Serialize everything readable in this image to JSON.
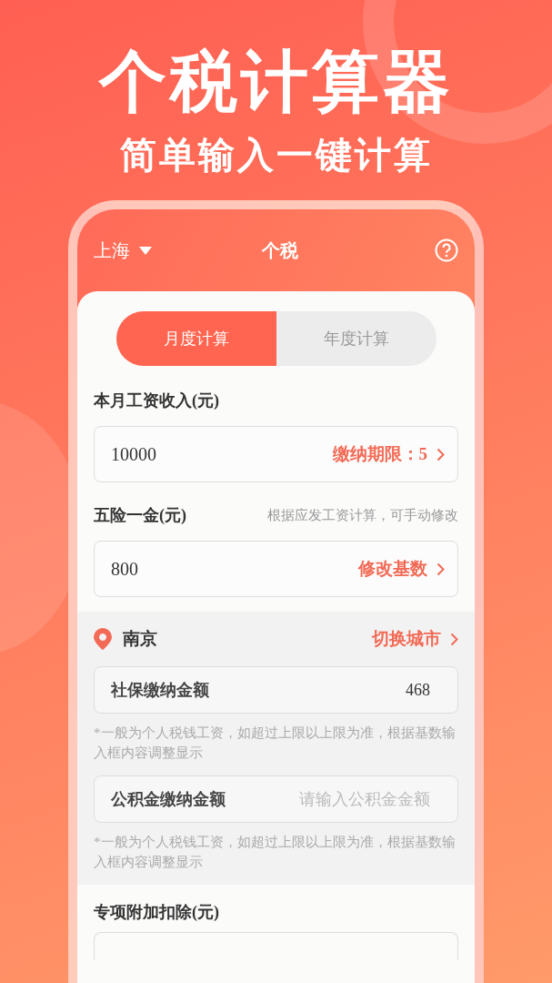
{
  "headline": "个税计算器",
  "subheadline": "简单输入一键计算",
  "app_bar": {
    "city": "上海",
    "title": "个税"
  },
  "tabs": [
    {
      "label": "月度计算",
      "selected": true
    },
    {
      "label": "年度计算",
      "selected": false
    }
  ],
  "salary": {
    "label": "本月工资收入(元)",
    "value": "10000",
    "action": "缴纳期限：5"
  },
  "insurance": {
    "label": "五险一金(元)",
    "hint": "根据应发工资计算，可手动修改",
    "value": "800",
    "action": "修改基数"
  },
  "city_section": {
    "city": "南京",
    "action": "切换城市",
    "fields": [
      {
        "label": "社保缴纳金额",
        "value": "468",
        "note": "*一般为个人税钱工资，如超过上限以上限为准，根据基数输入框内容调整显示"
      },
      {
        "label": "公积金缴纳金额",
        "placeholder": "请输入公积金金额",
        "note": "*一般为个人税钱工资，如超过上限以上限为准，根据基数输入框内容调整显示"
      }
    ]
  },
  "deductions": {
    "label": "专项附加扣除(元)"
  }
}
